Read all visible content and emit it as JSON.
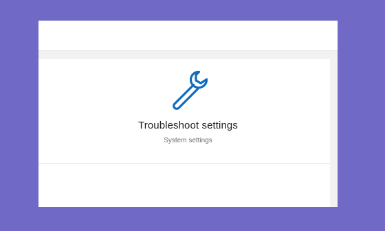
{
  "settings_card": {
    "title": "Troubleshoot settings",
    "subtitle": "System settings",
    "icon": "wrench-icon",
    "accent_color": "#0f6cbd"
  }
}
